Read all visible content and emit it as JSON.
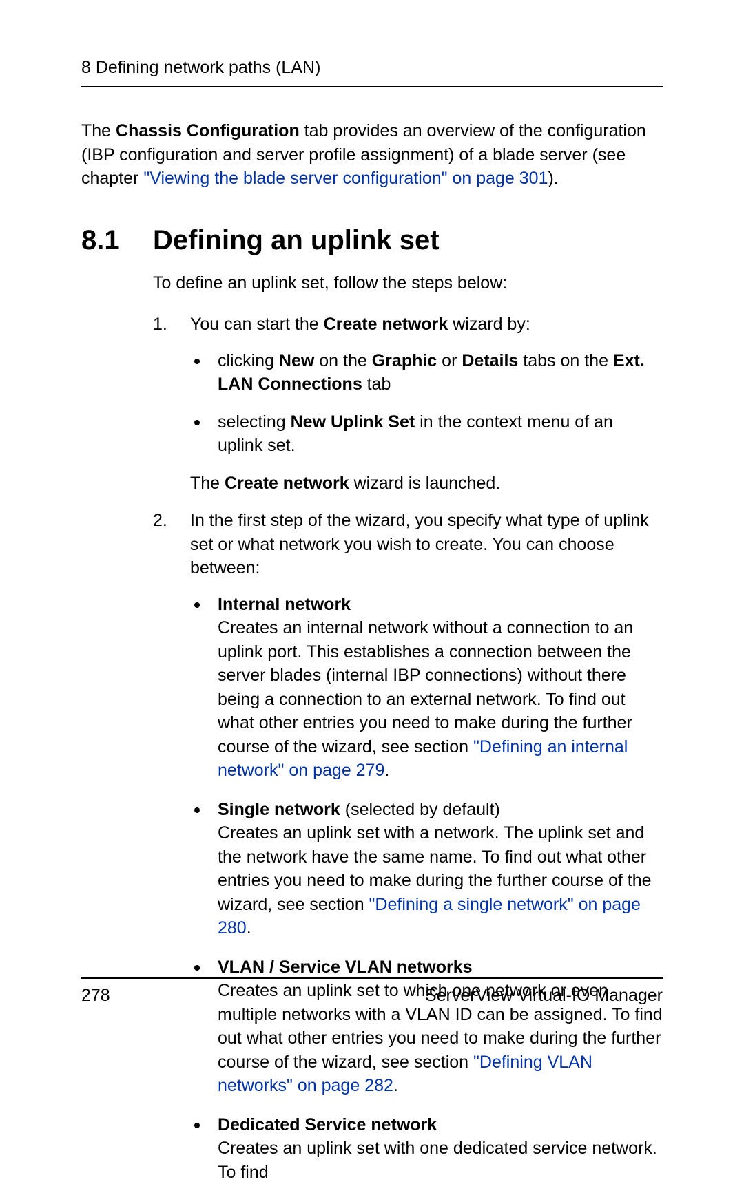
{
  "runningHead": "8 Defining network paths (LAN)",
  "intro": {
    "pre": "The ",
    "b1": "Chassis Configuration",
    "mid": " tab provides an overview of the configuration (IBP configuration and server profile assignment) of a blade server (see chapter ",
    "link": "\"Viewing the blade server configuration\" on page 301",
    "post": ")."
  },
  "h1": {
    "num": "8.1",
    "text": "Defining an uplink set"
  },
  "lead": "To define an uplink set, follow the steps below:",
  "step1": {
    "num": "1.",
    "pre": "You can start the ",
    "b": "Create network",
    "post": " wizard by:",
    "b1": {
      "t1": "clicking ",
      "b1": "New",
      "t2": " on the ",
      "b2": "Graphic",
      "t3": " or ",
      "b3": "Details",
      "t4": " tabs on the ",
      "b4": "Ext. LAN Connections",
      "t5": " tab"
    },
    "b2": {
      "t1": "selecting ",
      "b1": "New Uplink Set",
      "t2": " in the context menu of an uplink set."
    }
  },
  "afterStep1": {
    "t1": "The ",
    "b": "Create network",
    "t2": " wizard is launched."
  },
  "step2": {
    "num": "2.",
    "text": "In the first step of the wizard, you specify what type of uplink set or what network you wish to create. You can choose between:",
    "types": {
      "internal": {
        "title": "Internal network",
        "body1": "Creates an internal network without a connection to an uplink port. This establishes a connection between the server blades (internal IBP connections) without there being a connection to an external network. To find out what other entries you need to make during the further course of the wizard, see section ",
        "link": "\"Defining an internal network\" on page 279",
        "post": "."
      },
      "single": {
        "title": "Single network",
        "titleSuffix": " (selected by default)",
        "body1": "Creates an uplink set with a network. The uplink set and the network have the same name. To find out what other entries you need to make during the further course of the wizard, see section ",
        "link": "\"Defining a single network\" on page 280",
        "post": "."
      },
      "vlan": {
        "title": "VLAN / Service VLAN networks",
        "body1": "Creates an uplink set to which one network or even multiple networks with a VLAN ID can be assigned. To find out what other entries you need to make during the further course of the wizard, see section ",
        "link": "\"Defining VLAN networks\" on page 282",
        "post": "."
      },
      "dedicated": {
        "title": "Dedicated Service network",
        "body1": "Creates an uplink set with one dedicated service network. To find"
      }
    }
  },
  "footer": {
    "page": "278",
    "title": "ServerView Virtual-IO Manager"
  }
}
